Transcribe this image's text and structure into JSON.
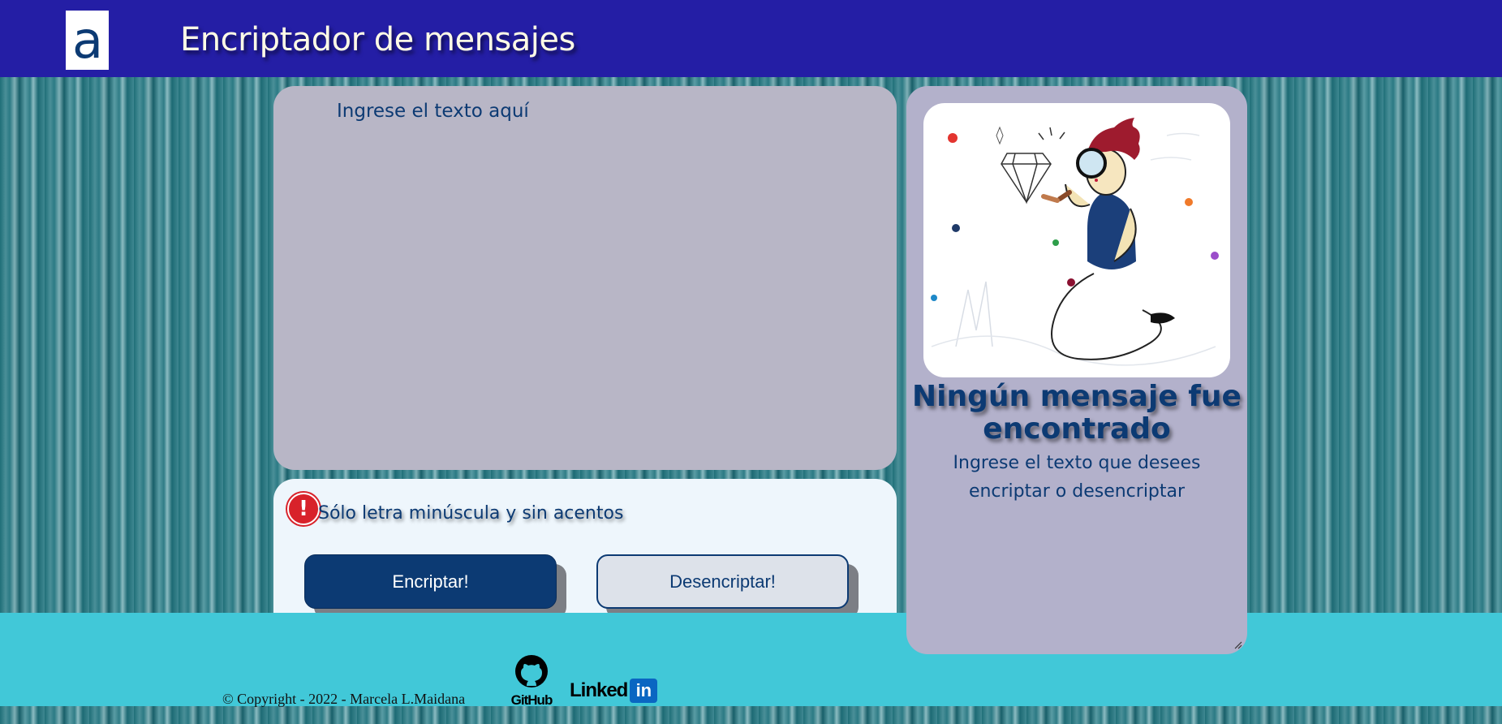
{
  "header": {
    "logo_letter": "a",
    "title": "Encriptador de mensajes"
  },
  "input": {
    "placeholder": "Ingrese el texto aquí",
    "value": ""
  },
  "controls": {
    "warning_icon": "exclamation-icon",
    "warning_text": "Sólo letra minúscula y sin acentos",
    "encrypt_label": "Encriptar!",
    "decrypt_label": "Desencriptar!"
  },
  "output": {
    "title": "Ningún mensaje fue encontrado",
    "subtitle": "Ingrese el texto que desees encriptar o desencriptar"
  },
  "footer": {
    "copyright": "© Copyright - 2022 - Marcela L.Maidana",
    "github_label": "GitHub",
    "linkedin_word": "Linked",
    "linkedin_box": "in"
  },
  "colors": {
    "header_bg": "#241ea5",
    "primary": "#0c3a73",
    "footer_bg": "#41c8d8",
    "input_panel": "#b8b6c6",
    "output_panel": "#b3b1cb",
    "warning": "#d8222a"
  }
}
